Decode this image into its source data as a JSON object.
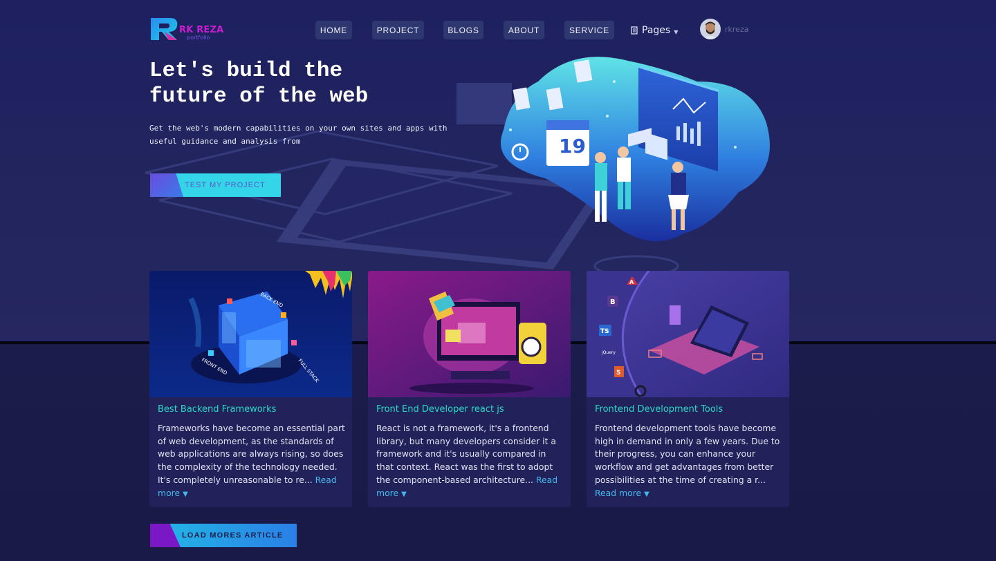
{
  "brand": {
    "name": "RK REZA",
    "tagline": "portfolio"
  },
  "nav": {
    "items": [
      "HOME",
      "PROJECT",
      "BLOGS",
      "ABOUT",
      "SERVICE"
    ],
    "pages_label": "Pages",
    "username": "rkreza"
  },
  "hero": {
    "title_line1": "Let's build the",
    "title_line2": "future of the web",
    "description": "Get the web's modern capabilities on your own sites and apps with useful guidance and analysis from",
    "cta_label": "TEST MY PROJECT",
    "calendar_number": "19"
  },
  "cards": [
    {
      "title": "Best Backend Frameworks",
      "excerpt": "Frameworks have become an essential part of web development, as the standards of web applications are always rising, so does the complexity of the technology needed. It's completely unreasonable to re...",
      "read_more": "Read more",
      "image_labels": [
        "BACK END",
        "FRONT END",
        "FULL STACK"
      ]
    },
    {
      "title": "Front End Developer react js",
      "excerpt": "React is not a framework, it's a frontend library, but many developers consider it a framework and it's usually compared in that context. React was the first to adopt the component-based architecture...",
      "read_more": "Read more"
    },
    {
      "title": "Frontend Development Tools",
      "excerpt": "Frontend development tools have become high in demand in only a few years. Due to their progress, you can enhance your workflow and get advantages from better possibilities at the time of creating a r...",
      "read_more": "Read more",
      "image_labels": [
        "A",
        "B",
        "TS",
        "jQuery",
        "5"
      ]
    }
  ],
  "load_more_label": "LOAD MORES ARTICLE",
  "colors": {
    "background": "#1b1b4d",
    "accent_teal": "#2fd8c6",
    "link_blue": "#45b7ee",
    "cta_cyan": "#34d5e8"
  }
}
